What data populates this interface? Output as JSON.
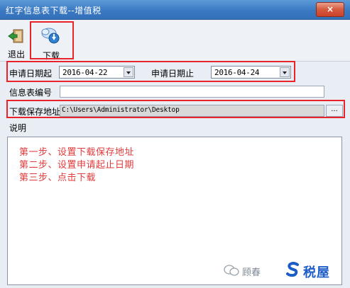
{
  "window": {
    "title": "红字信息表下载--增值税",
    "close_label": "×"
  },
  "toolbar": {
    "exit_label": "退出",
    "download_label": "下载"
  },
  "form": {
    "start_date_label": "申请日期起",
    "start_date_value": "2016-04-22",
    "end_date_label": "申请日期止",
    "end_date_value": "2016-04-24",
    "info_no_label": "信息表编号",
    "info_no_value": "",
    "save_path_label": "下载保存地址",
    "save_path_value": "C:\\Users\\Administrator\\Desktop",
    "browse_label": "...",
    "notes_label": "说明"
  },
  "notes": [
    "第一步、设置下载保存地址",
    "第二步、设置申请起止日期",
    "第三步、点击下载"
  ],
  "watermark": {
    "name": "顾春",
    "brand": "税屋"
  },
  "colors": {
    "highlight": "#e8242a",
    "note_text": "#e33a3a",
    "title_bar": "#3b79c3"
  }
}
